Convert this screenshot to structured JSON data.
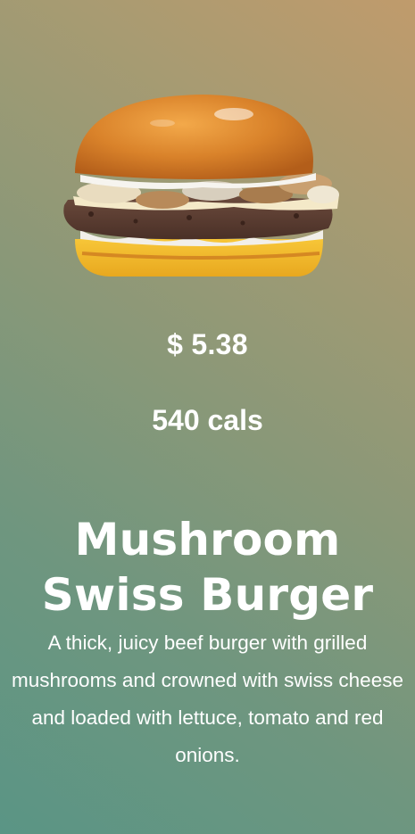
{
  "product": {
    "image": "mushroom-swiss-burger-image",
    "price": "$ 5.38",
    "calories": "540 cals",
    "title_line1": "Mushroom",
    "title_line2": "Swiss Burger",
    "description": "A thick, juicy beef burger with grilled mushrooms and crowned with swiss cheese and loaded with lettuce, tomato and red onions."
  },
  "colors": {
    "background_top_right": "#c09b6c",
    "background_bottom_left": "#5a9585",
    "text": "#ffffff"
  }
}
